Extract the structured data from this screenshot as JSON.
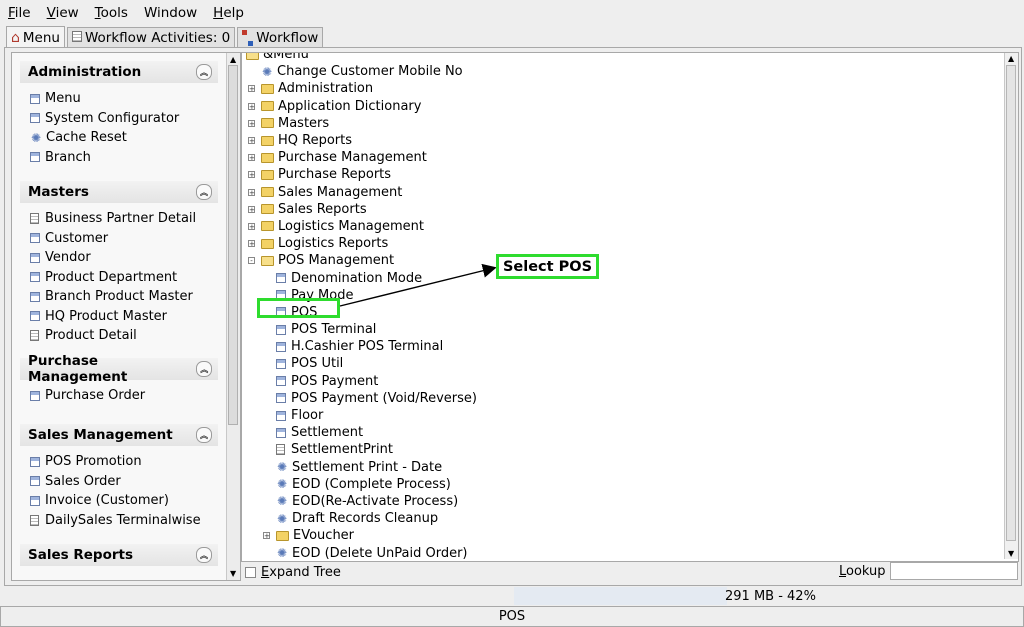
{
  "menubar": {
    "items": [
      {
        "label": "File",
        "mnemonic": "F",
        "rest": "ile"
      },
      {
        "label": "View",
        "mnemonic": "V",
        "rest": "iew"
      },
      {
        "label": "Tools",
        "mnemonic": "T",
        "rest": "ools"
      },
      {
        "label": "Window",
        "mnemonic": "",
        "rest": "Window"
      },
      {
        "label": "Help",
        "mnemonic": "H",
        "rest": "elp"
      }
    ]
  },
  "tabs": [
    {
      "label": "Menu",
      "icon": "home-icon",
      "active": true
    },
    {
      "label": "Workflow Activities: 0",
      "icon": "workflow-activities-icon",
      "active": false
    },
    {
      "label": "Workflow",
      "icon": "workflow-icon",
      "active": false
    }
  ],
  "sidebar": {
    "groups": [
      {
        "title": "Administration",
        "items": [
          {
            "label": "Menu",
            "icon": "window"
          },
          {
            "label": "System Configurator",
            "icon": "window"
          },
          {
            "label": "Cache Reset",
            "icon": "gear"
          },
          {
            "label": "Branch",
            "icon": "window"
          }
        ]
      },
      {
        "title": "Masters",
        "items": [
          {
            "label": "Business Partner Detail",
            "icon": "doc"
          },
          {
            "label": "Customer",
            "icon": "window"
          },
          {
            "label": "Vendor",
            "icon": "window"
          },
          {
            "label": "Product Department",
            "icon": "window"
          },
          {
            "label": "Branch Product Master",
            "icon": "window"
          },
          {
            "label": "HQ Product Master",
            "icon": "window"
          },
          {
            "label": "Product Detail",
            "icon": "doc"
          }
        ]
      },
      {
        "title": "Purchase Management",
        "items": [
          {
            "label": "Purchase Order",
            "icon": "window"
          }
        ]
      },
      {
        "title": "Sales Management",
        "items": [
          {
            "label": "POS Promotion",
            "icon": "window"
          },
          {
            "label": "Sales Order",
            "icon": "window"
          },
          {
            "label": "Invoice (Customer)",
            "icon": "window"
          },
          {
            "label": "DailySales Terminalwise",
            "icon": "doc"
          }
        ]
      },
      {
        "title": "Sales Reports",
        "items": []
      }
    ]
  },
  "tree": {
    "rows": [
      {
        "label": "&Menu",
        "level": 0,
        "icon": "folder-open",
        "expander": ""
      },
      {
        "label": "Change Customer Mobile No",
        "level": 1,
        "icon": "gear",
        "expander": ""
      },
      {
        "label": "Administration",
        "level": 1,
        "icon": "folder",
        "expander": "+"
      },
      {
        "label": "Application Dictionary",
        "level": 1,
        "icon": "folder",
        "expander": "+"
      },
      {
        "label": "Masters",
        "level": 1,
        "icon": "folder",
        "expander": "+"
      },
      {
        "label": "HQ Reports",
        "level": 1,
        "icon": "folder",
        "expander": "+"
      },
      {
        "label": "Purchase Management",
        "level": 1,
        "icon": "folder",
        "expander": "+"
      },
      {
        "label": "Purchase Reports",
        "level": 1,
        "icon": "folder",
        "expander": "+"
      },
      {
        "label": "Sales Management",
        "level": 1,
        "icon": "folder",
        "expander": "+"
      },
      {
        "label": "Sales Reports",
        "level": 1,
        "icon": "folder",
        "expander": "+"
      },
      {
        "label": "Logistics Management",
        "level": 1,
        "icon": "folder",
        "expander": "+"
      },
      {
        "label": "Logistics Reports",
        "level": 1,
        "icon": "folder",
        "expander": "+"
      },
      {
        "label": "POS Management",
        "level": 1,
        "icon": "folder-open",
        "expander": "-"
      },
      {
        "label": "Denomination Mode",
        "level": 2,
        "icon": "window",
        "expander": ""
      },
      {
        "label": "Pay Mode",
        "level": 2,
        "icon": "window",
        "expander": ""
      },
      {
        "label": "POS",
        "level": 2,
        "icon": "window",
        "expander": ""
      },
      {
        "label": "POS Terminal",
        "level": 2,
        "icon": "window",
        "expander": ""
      },
      {
        "label": "H.Cashier POS Terminal",
        "level": 2,
        "icon": "window",
        "expander": ""
      },
      {
        "label": "POS Util",
        "level": 2,
        "icon": "window",
        "expander": ""
      },
      {
        "label": "POS Payment",
        "level": 2,
        "icon": "window",
        "expander": ""
      },
      {
        "label": "POS Payment (Void/Reverse)",
        "level": 2,
        "icon": "window",
        "expander": ""
      },
      {
        "label": "Floor",
        "level": 2,
        "icon": "window",
        "expander": ""
      },
      {
        "label": "Settlement",
        "level": 2,
        "icon": "window",
        "expander": ""
      },
      {
        "label": "SettlementPrint",
        "level": 2,
        "icon": "doc",
        "expander": ""
      },
      {
        "label": "Settlement Print - Date",
        "level": 2,
        "icon": "gear",
        "expander": ""
      },
      {
        "label": "EOD (Complete Process)",
        "level": 2,
        "icon": "gear",
        "expander": ""
      },
      {
        "label": "EOD(Re-Activate Process)",
        "level": 2,
        "icon": "gear",
        "expander": ""
      },
      {
        "label": "Draft Records Cleanup",
        "level": 2,
        "icon": "gear",
        "expander": ""
      },
      {
        "label": "EVoucher",
        "level": 2,
        "icon": "folder",
        "expander": "+"
      },
      {
        "label": "EOD (Delete UnPaid Order)",
        "level": 2,
        "icon": "gear",
        "expander": ""
      }
    ]
  },
  "tree_bottom": {
    "expand_label": "Expand Tree",
    "lookup_label": "Lookup",
    "lookup_value": ""
  },
  "annotation": {
    "callout_text": "Select POS",
    "highlight_color": "#2edc2e"
  },
  "memory": {
    "text": "291 MB - 42%",
    "fraction": 0.42
  },
  "status": {
    "text": "POS"
  },
  "colors": {
    "folder": "#f3d266",
    "window_icon": "#9fb4dd"
  }
}
